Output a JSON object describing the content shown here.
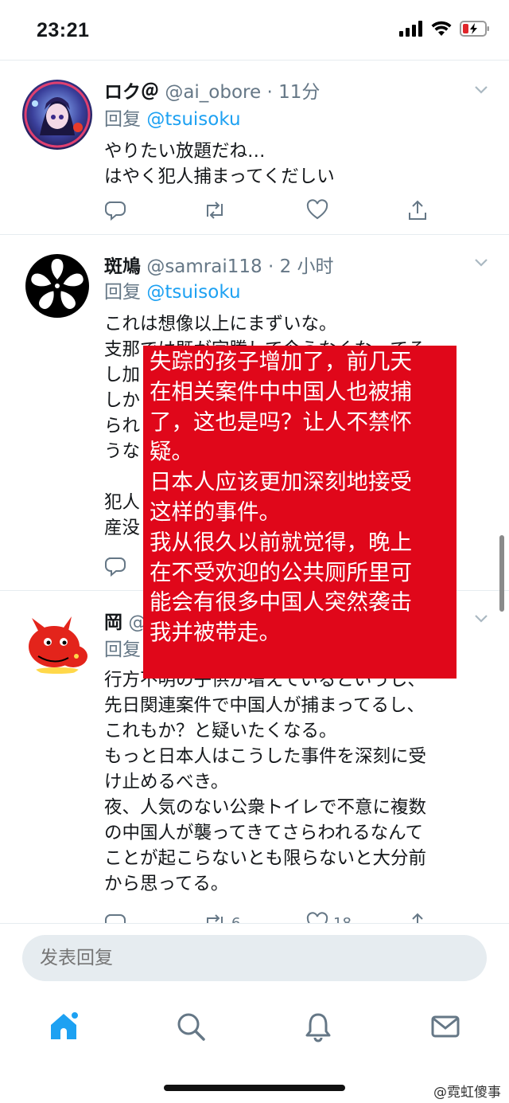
{
  "status_bar": {
    "time": "23:21"
  },
  "tweets": [
    {
      "name": "ロク＠",
      "handle": "@ai_obore",
      "sep": "·",
      "time": "11分",
      "reply_label": "回复",
      "reply_to": "@tsuisoku",
      "text": "やりたい放題だね…\nはやく犯人捕まってくだしい"
    },
    {
      "name": "斑鳩",
      "handle": "@samrai118",
      "sep": "·",
      "time": "2 小时",
      "reply_label": "回复",
      "reply_to": "@tsuisoku",
      "text": "これは想像以上にまずいな。\n支那では既が字騰して今うなくな　てる\nし加\nしか　　　　　　　　　　　　　　限\nられ　　　　　　　　　　　　　　そ\nうな\n\n犯人　　　　　　　　　　　　　　財\n産没"
    },
    {
      "name": "岡",
      "handle": "@",
      "reply_label": "回复",
      "text": "行方不明の子供が増えているというし、\n先日関連案件で中国人が捕まってるし、\nこれもか？と疑いたくなる。\nもっと日本人はこうした事件を深刻に受\nけ止めるべき。\n夜、人気のない公衆トイレで不意に複数\nの中国人が襲ってきてさらわれるなんて\nことが起こらないとも限らないと大分前\nから思ってる。",
      "retweets": "6",
      "likes": "18"
    }
  ],
  "overlay_caption": "失踪的孩子增加了，前几天\n在相关案件中中国人也被捕\n了，这也是吗？让人不禁怀\n疑。\n日本人应该更加深刻地接受\n这样的事件。\n我从很久以前就觉得，晚上\n在不受欢迎的公共厕所里可\n能会有很多中国人突然袭击\n我并被带走。",
  "reply_bar": {
    "placeholder": "发表回复"
  },
  "tabs": [
    "home-icon",
    "search-icon",
    "notifications-icon",
    "messages-icon"
  ],
  "watermark": "@霓虹傻事",
  "colors": {
    "link": "#1da1f2",
    "muted": "#657786",
    "overlay": "#e0071a"
  }
}
